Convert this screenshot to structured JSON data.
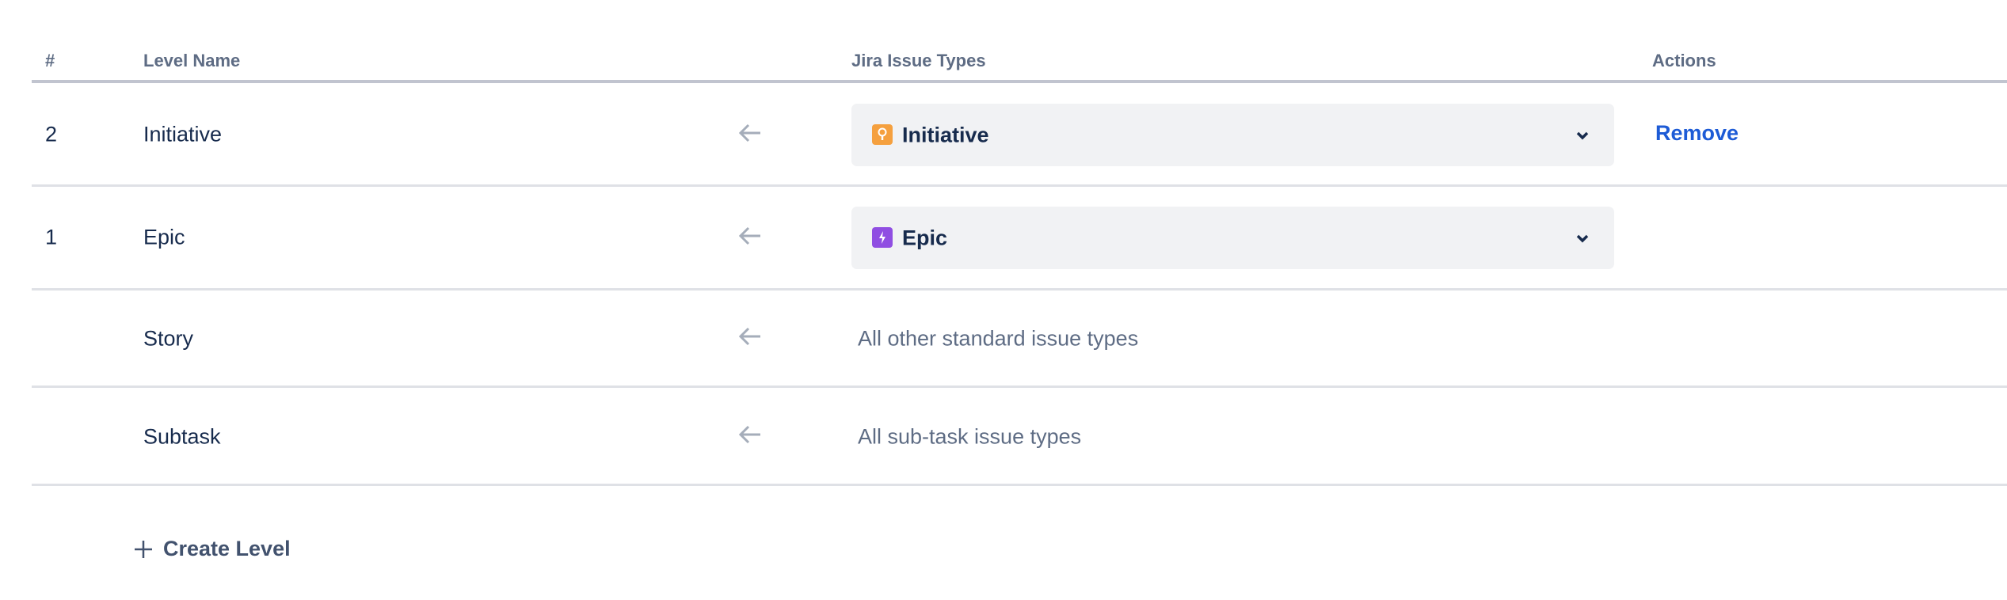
{
  "table": {
    "headers": {
      "num": "#",
      "level_name": "Level Name",
      "issue_types": "Jira Issue Types",
      "actions": "Actions"
    },
    "rows": [
      {
        "num": "2",
        "level_name": "Initiative",
        "issue_type": "Initiative",
        "issue_icon": "lightbulb-icon",
        "icon_color": "#f5a03e",
        "action": "Remove"
      },
      {
        "num": "1",
        "level_name": "Epic",
        "issue_type": "Epic",
        "issue_icon": "lightning-icon",
        "icon_color": "#904ee2"
      },
      {
        "level_name": "Story",
        "issue_type_text": "All other standard issue types"
      },
      {
        "level_name": "Subtask",
        "issue_type_text": "All sub-task issue types"
      }
    ]
  },
  "create_level_label": "Create Level"
}
